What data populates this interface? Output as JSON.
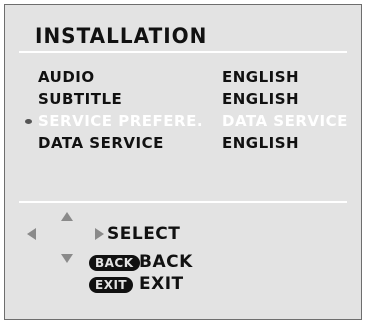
{
  "title": "INSTALLATION",
  "rows": [
    {
      "label": "AUDIO",
      "value": "ENGLISH"
    },
    {
      "label": "SUBTITLE",
      "value": "ENGLISH"
    },
    {
      "label": "SERVICE PREFERE.",
      "value": "DATA SERVICE"
    },
    {
      "label": "DATA SERVICE",
      "value": "ENGLISH"
    }
  ],
  "nav": {
    "select_label": "SELECT",
    "back_key": "BACK",
    "back_label": "BACK",
    "exit_key": "EXIT",
    "exit_label": "EXIT"
  },
  "colors": {
    "panel_bg": "#e3e3e3",
    "text": "#111111",
    "highlight_text": "#ffffff",
    "arrow": "#8a8a8a"
  }
}
